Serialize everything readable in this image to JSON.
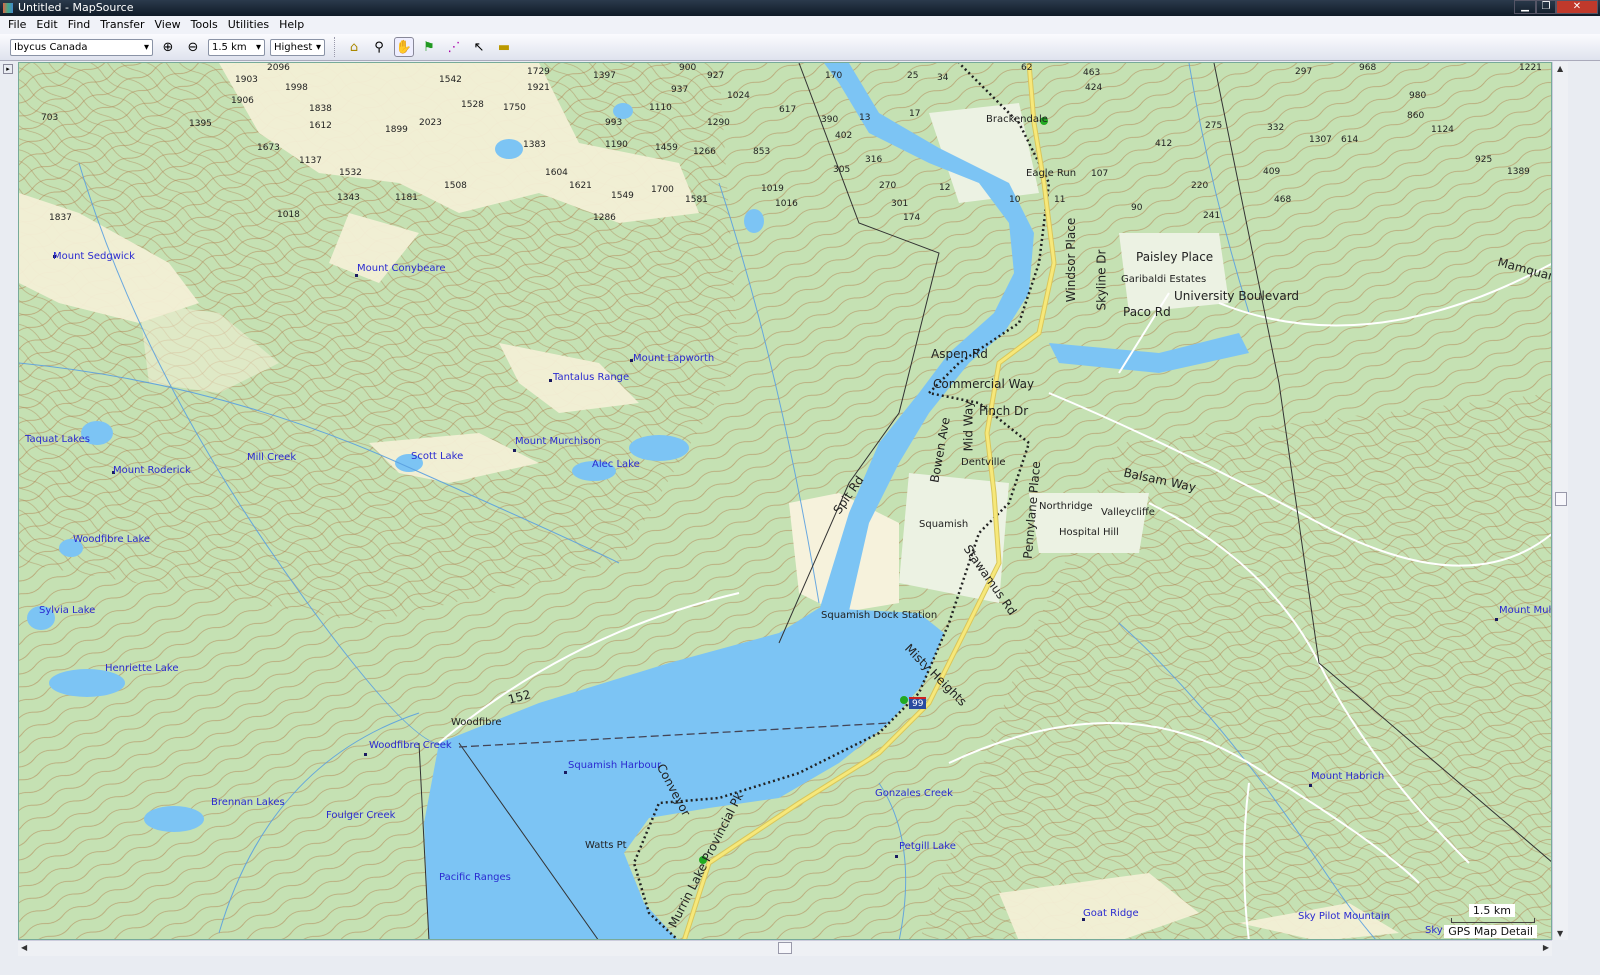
{
  "window": {
    "title": "Untitled - MapSource",
    "min": "▁",
    "max": "❐",
    "close": "✕"
  },
  "menu": [
    "File",
    "Edit",
    "Find",
    "Transfer",
    "View",
    "Tools",
    "Utilities",
    "Help"
  ],
  "toolbar": {
    "map_product": "Ibycus Canada",
    "zoom_scale": "1.5 km",
    "detail": "Highest"
  },
  "map": {
    "places": [
      "Mount Sedgwick",
      "Mount Conybeare",
      "Mount Lapworth",
      "Tantalus Range",
      "Taquat Lakes",
      "Mount Roderick",
      "Mill Creek",
      "Scott Lake",
      "Mount Murchison",
      "Alec Lake",
      "Woodfibre Lake",
      "Sylvia Lake",
      "Henriette Lake",
      "Woodfibre",
      "Woodfibre Creek",
      "Squamish Harbour",
      "Brennan Lakes",
      "Foulger Creek",
      "Pacific Ranges",
      "Gonzales Creek",
      "Petgill Lake",
      "Goat Ridge",
      "Sky Pilot Mountain",
      "Mount Habrich",
      "Mount Mulli",
      "Sky Pi"
    ],
    "towns": [
      "Squamish Dock Station",
      "Squamish",
      "Dentville",
      "Northridge",
      "Hospital Hill",
      "Valleycliffe",
      "Brackendale",
      "Eagle Run",
      "Garibaldi Estates",
      "Watts Pt"
    ],
    "roads": [
      "Paisley Place",
      "University Boulevard",
      "Paco Rd",
      "Aspen Rd",
      "Commercial Way",
      "Finch Dr",
      "Balsam Way",
      "Mamquam",
      "Windsor Place",
      "Skyline Dr",
      "Mid Way",
      "Bowen Ave",
      "Pennylane Place",
      "Spit Rd",
      "Stawamus Rd",
      "Misty Heights",
      "Conveyor",
      "Murrin Lake Provincial Pk",
      "152"
    ],
    "highway_shield": "99",
    "elevations": [
      "703",
      "1903",
      "2096",
      "1998",
      "1906",
      "1395",
      "1838",
      "1612",
      "1673",
      "1899",
      "2023",
      "1137",
      "1532",
      "1343",
      "1181",
      "1508",
      "1837",
      "1018",
      "1542",
      "1528",
      "1750",
      "1729",
      "1921",
      "1397",
      "993",
      "1110",
      "1383",
      "1190",
      "1459",
      "1604",
      "1621",
      "1549",
      "1700",
      "1286",
      "1581",
      "900",
      "927",
      "937",
      "1024",
      "1290",
      "1266",
      "853",
      "617",
      "1019",
      "1016",
      "390",
      "402",
      "305",
      "316",
      "270",
      "301",
      "174",
      "170",
      "13",
      "17",
      "34",
      "25",
      "62",
      "463",
      "424",
      "412",
      "275",
      "332",
      "297",
      "980",
      "1124",
      "1307",
      "860",
      "614",
      "925",
      "1389",
      "409",
      "468",
      "220",
      "241",
      "107",
      "90",
      "12",
      "10",
      "11",
      "1221",
      "968"
    ],
    "scale_label": "1.5 km",
    "detail_label": "GPS Map Detail"
  }
}
